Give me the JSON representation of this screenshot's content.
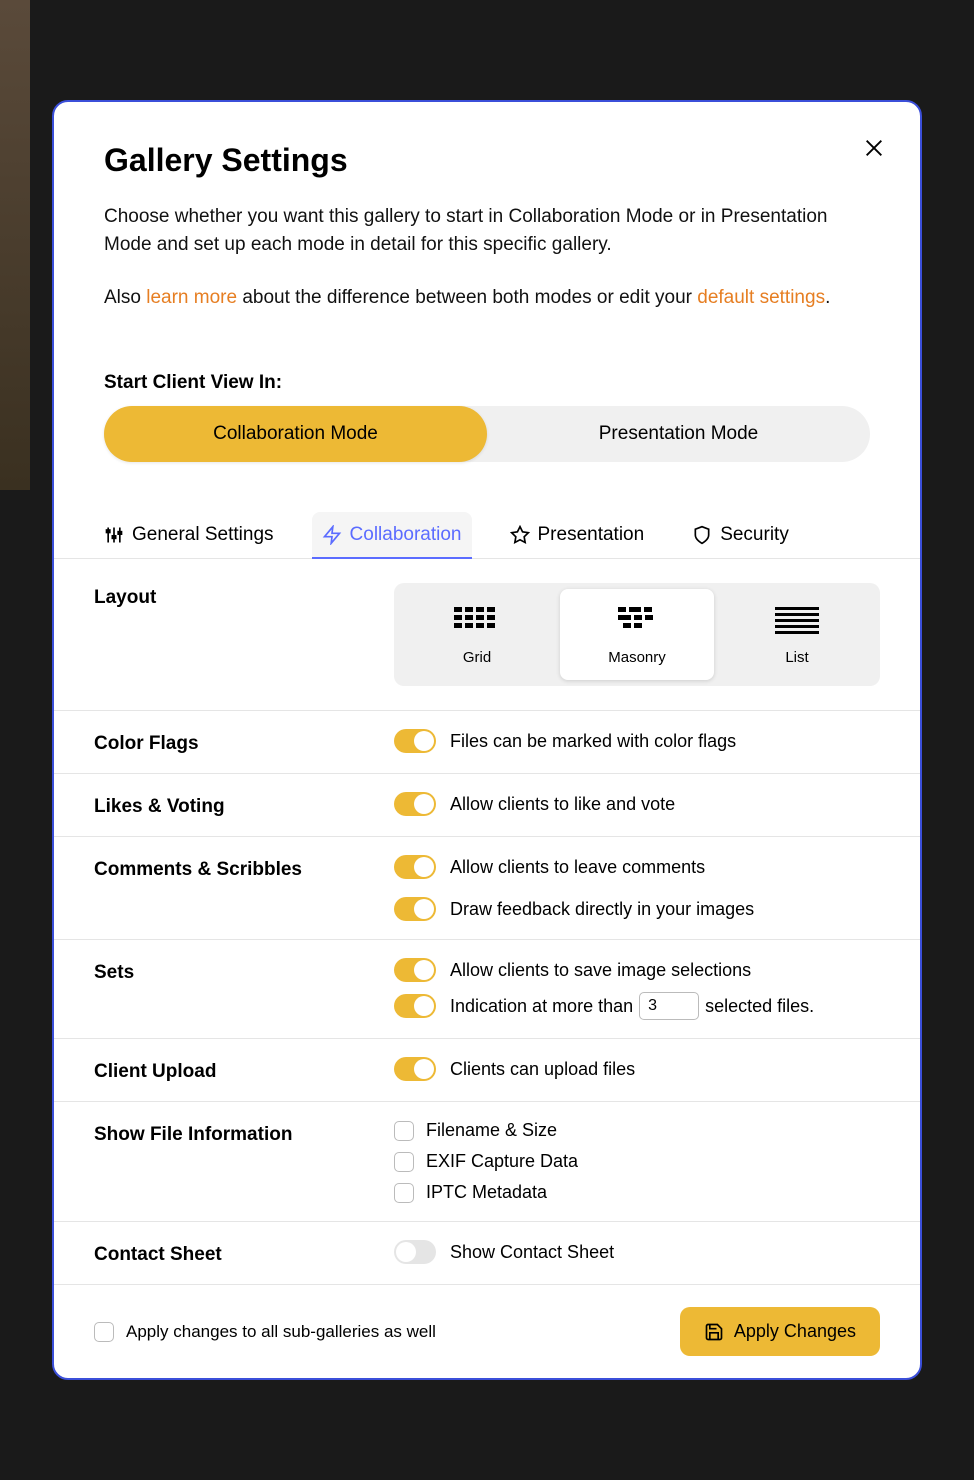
{
  "title": "Gallery Settings",
  "description": "Choose whether you want this gallery to start in Collaboration Mode or in Presentation Mode and set up each mode in detail for this specific gallery.",
  "desc2_prefix": "Also ",
  "desc2_link1": "learn more",
  "desc2_middle": " about the difference between both modes or edit your ",
  "desc2_link2": "default settings",
  "desc2_suffix": ".",
  "start_view_label": "Start Client View In:",
  "segments": {
    "collaboration": "Collaboration Mode",
    "presentation": "Presentation Mode"
  },
  "tabs": {
    "general": "General Settings",
    "collaboration": "Collaboration",
    "presentation": "Presentation",
    "security": "Security"
  },
  "settings": {
    "layout": {
      "label": "Layout",
      "options": {
        "grid": "Grid",
        "masonry": "Masonry",
        "list": "List"
      }
    },
    "color_flags": {
      "label": "Color Flags",
      "toggle_label": "Files can be marked with color flags"
    },
    "likes": {
      "label": "Likes & Voting",
      "toggle_label": "Allow clients to like and vote"
    },
    "comments": {
      "label": "Comments & Scribbles",
      "toggle1": "Allow clients to leave comments",
      "toggle2": "Draw feedback directly in your images"
    },
    "sets": {
      "label": "Sets",
      "toggle1": "Allow clients to save image selections",
      "indication_prefix": "Indication at more than",
      "indication_value": "3",
      "indication_suffix": "selected files."
    },
    "client_upload": {
      "label": "Client Upload",
      "toggle_label": "Clients can upload files"
    },
    "file_info": {
      "label": "Show File Information",
      "opt1": "Filename & Size",
      "opt2": "EXIF Capture Data",
      "opt3": "IPTC Metadata"
    },
    "contact_sheet": {
      "label": "Contact Sheet",
      "toggle_label": "Show Contact Sheet"
    }
  },
  "footer": {
    "apply_all": "Apply changes to all sub-galleries as well",
    "apply_button": "Apply Changes"
  }
}
